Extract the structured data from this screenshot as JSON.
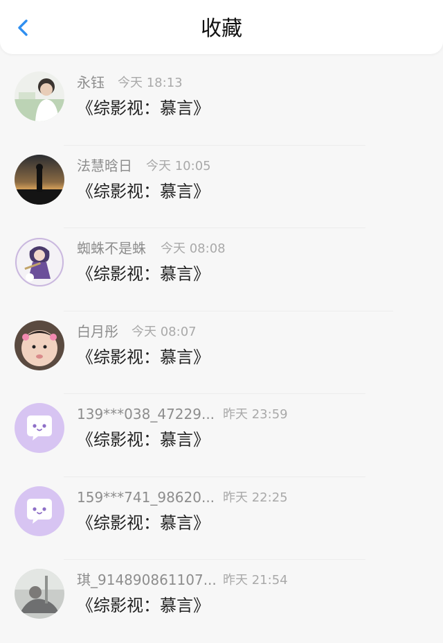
{
  "header": {
    "title": "收藏"
  },
  "items": [
    {
      "name": "永钰",
      "time": "今天 18:13",
      "content": "《综影视：慕言》"
    },
    {
      "name": "法慧晗日",
      "time": "今天 10:05",
      "content": "《综影视：慕言》"
    },
    {
      "name": "蜘蛛不是蛛",
      "time": "今天 08:08",
      "content": "《综影视：慕言》"
    },
    {
      "name": "白月彤",
      "time": "今天 08:07",
      "content": "《综影视：慕言》"
    },
    {
      "name": "139***038_47229...",
      "time": "昨天 23:59",
      "content": "《综影视：慕言》"
    },
    {
      "name": "159***741_98620...",
      "time": "昨天 22:25",
      "content": "《综影视：慕言》"
    },
    {
      "name": "琪_914890861107...",
      "time": "昨天 21:54",
      "content": "《综影视：慕言》"
    }
  ],
  "colors": {
    "accent": "#2f8ff0",
    "default_avatar": "#d7c4f2"
  }
}
